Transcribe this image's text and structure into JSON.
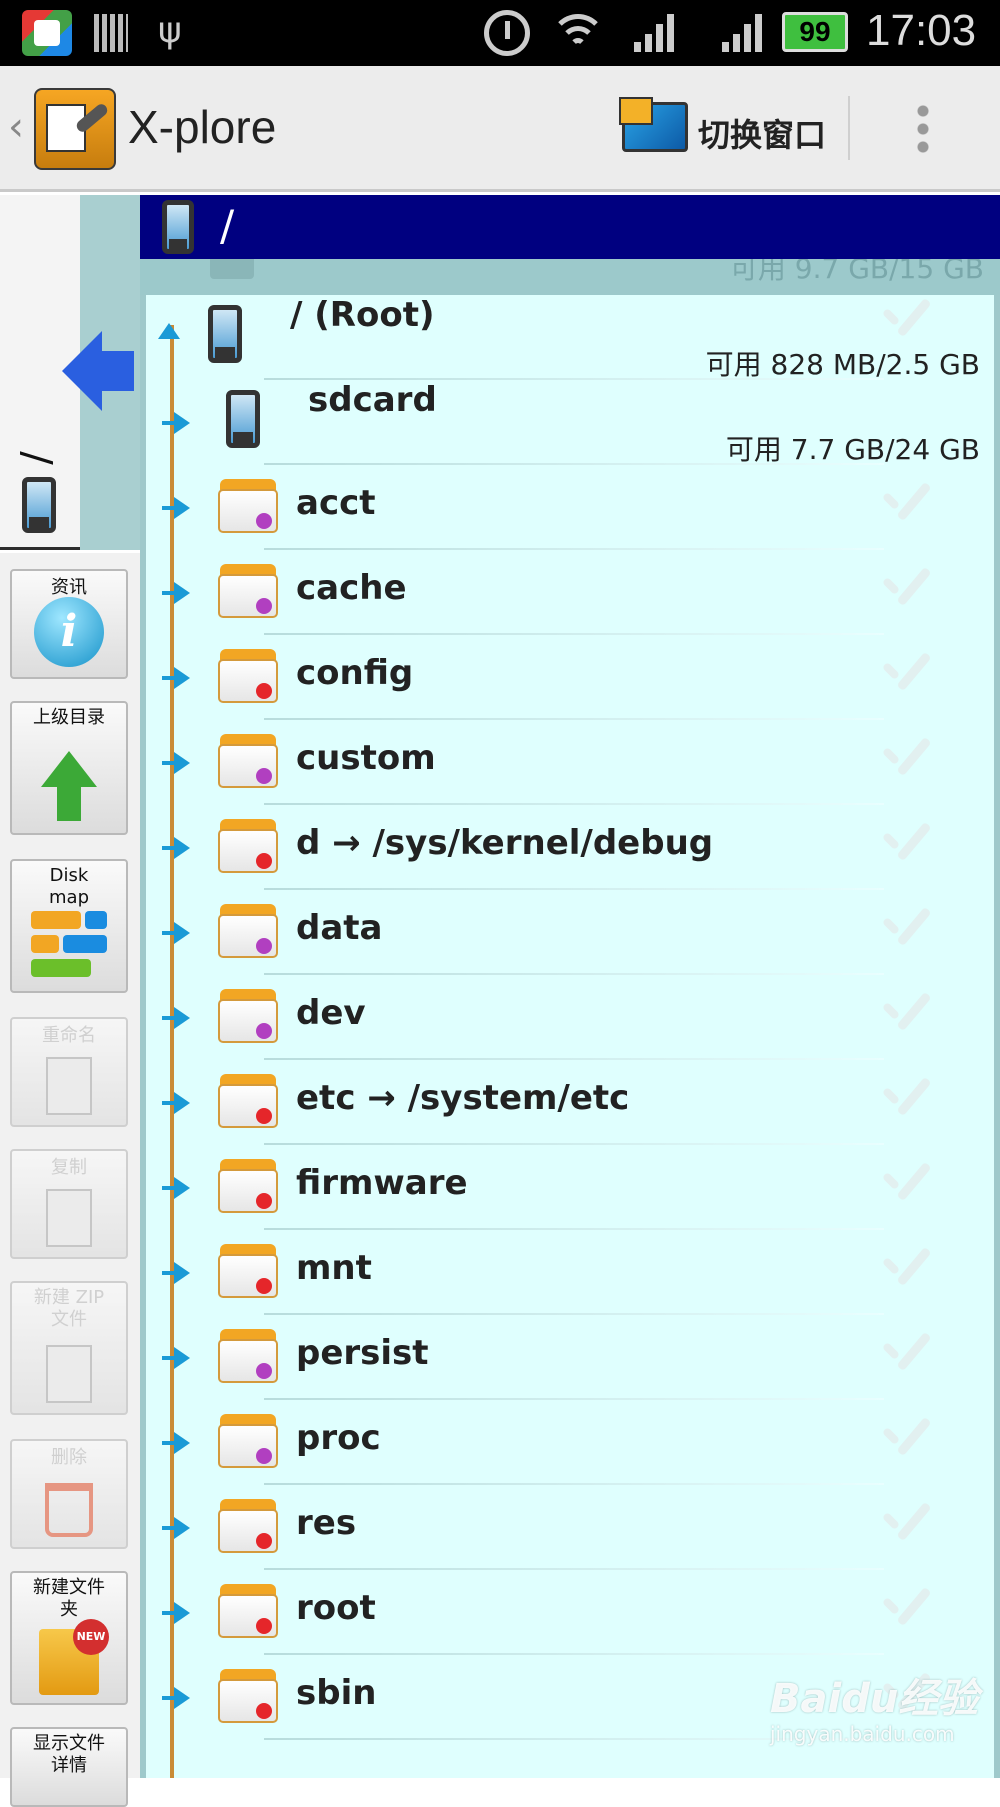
{
  "status_bar": {
    "battery": "99",
    "time": "17:03"
  },
  "action_bar": {
    "title": "X-plore",
    "switch_window": "切换窗口"
  },
  "left_strip": {
    "path": "/"
  },
  "tools": [
    {
      "label": "资讯",
      "icon": "info-icon",
      "enabled": true
    },
    {
      "label": "上级目录",
      "icon": "up-arrow-icon",
      "enabled": true
    },
    {
      "label": "Disk map",
      "icon": "disk-map-icon",
      "enabled": true
    },
    {
      "label": "重命名",
      "icon": "rename-icon",
      "enabled": false
    },
    {
      "label": "复制",
      "icon": "copy-icon",
      "enabled": false
    },
    {
      "label": "新建 ZIP 文件",
      "icon": "zip-icon",
      "enabled": false
    },
    {
      "label": "删除",
      "icon": "trash-icon",
      "enabled": false
    },
    {
      "label": "新建文件夹",
      "icon": "new-folder-icon",
      "enabled": true
    },
    {
      "label": "显示文件详情",
      "icon": "details-icon",
      "enabled": true
    }
  ],
  "path_bar": {
    "path": "/"
  },
  "ghost_row": {
    "free": "可用 9.7 GB/15 GB"
  },
  "disks": [
    {
      "name": "/ (Root)",
      "free": "可用 828 MB/2.5 GB",
      "expanded": true
    },
    {
      "name": "sdcard",
      "free": "可用 7.7 GB/24 GB",
      "expanded": false
    }
  ],
  "folders": [
    {
      "name": "acct",
      "dot": "#b13fc0"
    },
    {
      "name": "cache",
      "dot": "#b13fc0"
    },
    {
      "name": "config",
      "dot": "#e5262a"
    },
    {
      "name": "custom",
      "dot": "#b13fc0"
    },
    {
      "name": "d → /sys/kernel/debug",
      "dot": "#e5262a"
    },
    {
      "name": "data",
      "dot": "#b13fc0"
    },
    {
      "name": "dev",
      "dot": "#b13fc0"
    },
    {
      "name": "etc → /system/etc",
      "dot": "#e5262a"
    },
    {
      "name": "firmware",
      "dot": "#e5262a"
    },
    {
      "name": "mnt",
      "dot": "#e5262a"
    },
    {
      "name": "persist",
      "dot": "#b13fc0"
    },
    {
      "name": "proc",
      "dot": "#b13fc0"
    },
    {
      "name": "res",
      "dot": "#e5262a"
    },
    {
      "name": "root",
      "dot": "#e5262a"
    },
    {
      "name": "sbin",
      "dot": "#e5262a"
    }
  ],
  "watermark": {
    "main": "Baidu经验",
    "sub": "jingyan.baidu.com"
  }
}
